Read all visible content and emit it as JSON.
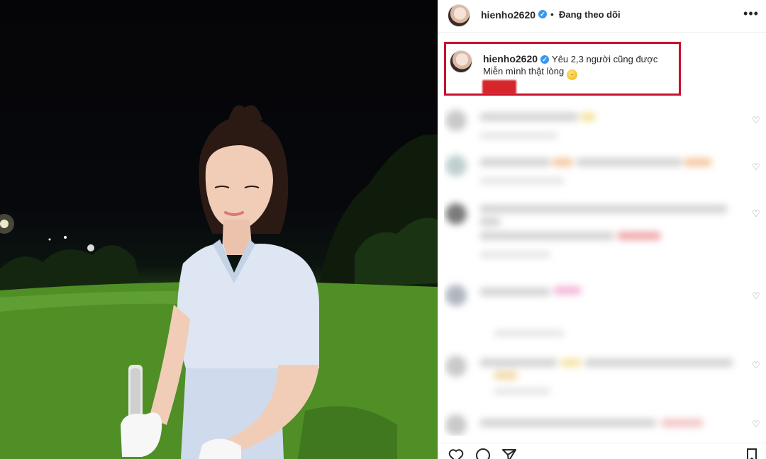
{
  "post": {
    "header": {
      "username": "hienho2620",
      "verified_mark": "✓",
      "separator": "•",
      "follow_state": "Đang theo dõi",
      "more_label": "•••",
      "more_icon": "more-horizontal-icon"
    },
    "caption": {
      "username": "hienho2620",
      "line1": "Yêu 2,3 người cũng được",
      "line2": "Miễn mình thật lòng",
      "emoji": "🤤",
      "highlight_color": "#c8102e"
    },
    "comments_blurred": true,
    "actions": {
      "like_icon": "heart-outline-icon",
      "comment_icon": "comment-bubble-icon",
      "share_icon": "paper-plane-icon",
      "save_icon": "bookmark-icon"
    }
  },
  "colors": {
    "accent_blue": "#3897f0",
    "highlight_red": "#c8102e",
    "text": "#262626",
    "muted": "#8e8e8e"
  }
}
